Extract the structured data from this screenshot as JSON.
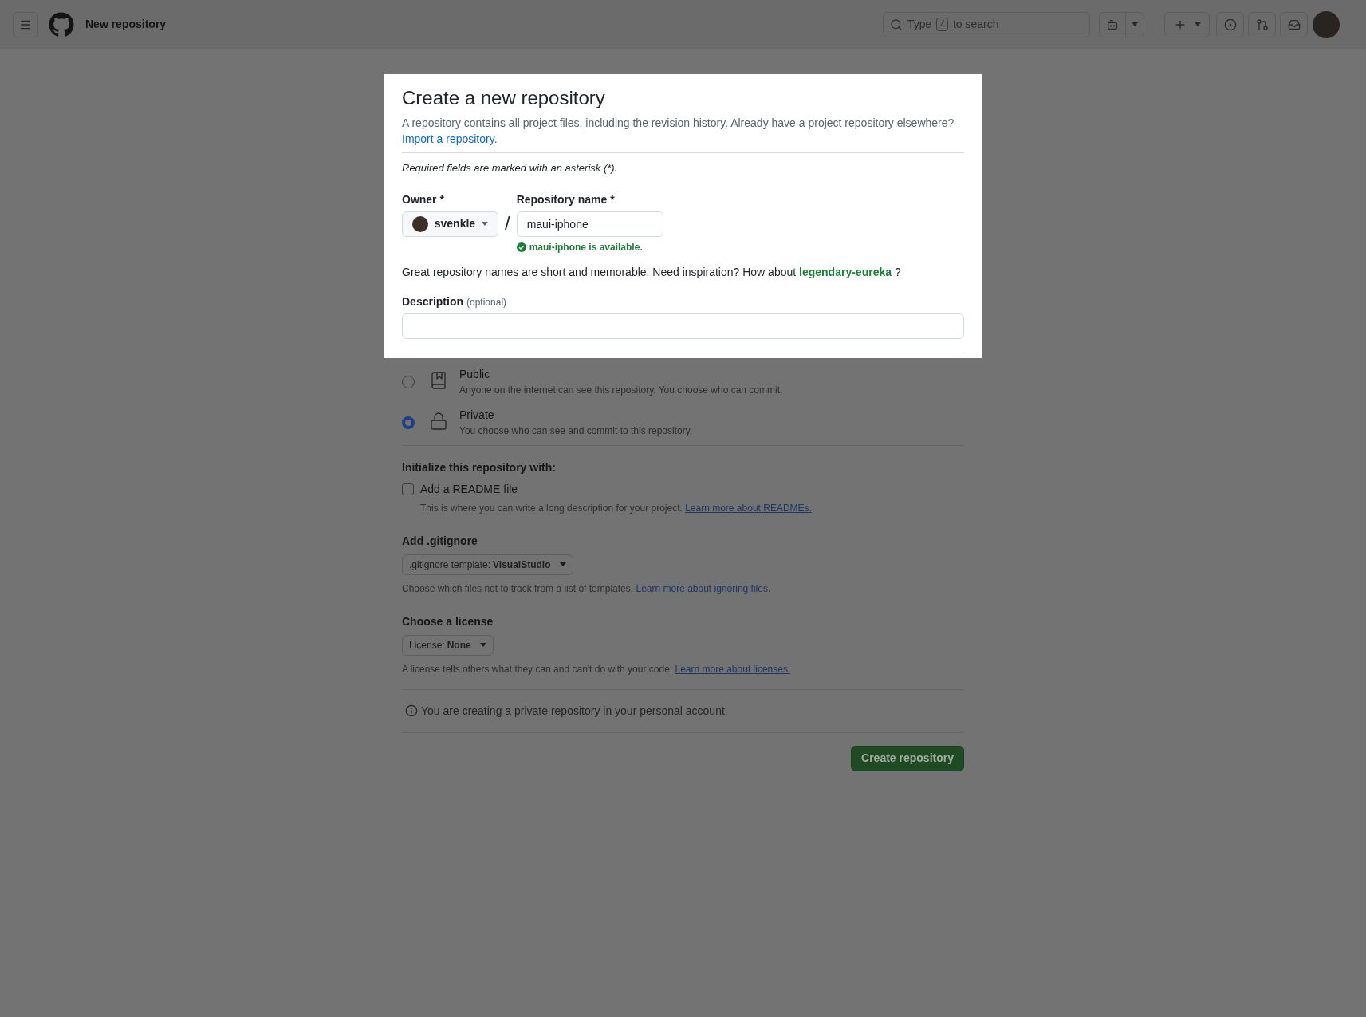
{
  "header": {
    "title": "New repository",
    "search_before": "Type",
    "search_key": "/",
    "search_after": "to search"
  },
  "form": {
    "title": "Create a new repository",
    "intro": "A repository contains all project files, including the revision history. Already have a project repository elsewhere?",
    "import_link": "Import a repository",
    "intro_end": ".",
    "required_note": "Required fields are marked with an asterisk (*).",
    "owner": {
      "label": "Owner *",
      "value": "svenkle"
    },
    "separator": "/",
    "repo_name": {
      "label": "Repository name *",
      "value": "maui-iphone",
      "status": "maui-iphone is available."
    },
    "suggestion": {
      "text": "Great repository names are short and memorable. Need inspiration? How about",
      "name": "legendary-eureka",
      "end": "?"
    },
    "description": {
      "label": "Description",
      "hint": "(optional)"
    }
  },
  "visibility": [
    {
      "kind": "public",
      "label": "Public",
      "note": "Anyone on the internet can see this repository. You choose who can commit.",
      "selected": false
    },
    {
      "kind": "private",
      "label": "Private",
      "note": "You choose who can see and commit to this repository.",
      "selected": true
    }
  ],
  "initialize": {
    "heading": "Initialize this repository with:",
    "readme": {
      "label": "Add a README file",
      "checked": false,
      "note": "This is where you can write a long description for your project.",
      "link": "Learn more about READMEs."
    }
  },
  "gitignore": {
    "heading": "Add .gitignore",
    "prefix": ".gitignore template:",
    "value": "VisualStudio",
    "note": "Choose which files not to track from a list of templates.",
    "link": "Learn more about ignoring files."
  },
  "license": {
    "heading": "Choose a license",
    "prefix": "License:",
    "value": "None",
    "note": "A license tells others what they can and can't do with your code.",
    "link": "Learn more about licenses."
  },
  "notice": "You are creating a private repository in your personal account.",
  "submit": "Create repository"
}
